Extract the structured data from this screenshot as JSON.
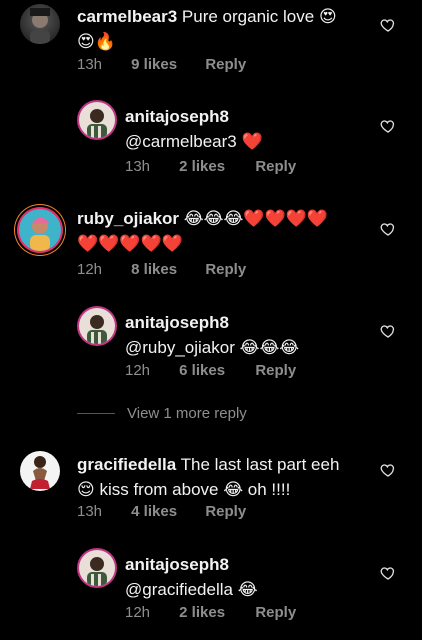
{
  "comments": [
    {
      "user": "carmelbear3",
      "text_line1": "Pure organic love 😍",
      "text_line2": "😍🔥",
      "time": "13h",
      "likes": "9 likes",
      "reply": "Reply"
    },
    {
      "user": "anitajoseph8",
      "text_line1": "@carmelbear3 ❤️",
      "time": "13h",
      "likes": "2 likes",
      "reply": "Reply"
    },
    {
      "user": "ruby_ojiakor",
      "text_line1": "😂😂😂❤️❤️❤️❤️",
      "text_line2": "❤️❤️❤️❤️❤️",
      "time": "12h",
      "likes": "8 likes",
      "reply": "Reply"
    },
    {
      "user": "anitajoseph8",
      "text_line1": "@ruby_ojiakor 😂😂😂",
      "time": "12h",
      "likes": "6 likes",
      "reply": "Reply"
    },
    {
      "user": "gracifiedella",
      "text_line1": "The last last part eeh",
      "text_line2": "😌 kiss from above 😂 oh !!!!",
      "time": "13h",
      "likes": "4 likes",
      "reply": "Reply"
    },
    {
      "user": "anitajoseph8",
      "text_line1": "@gracifiedella 😂",
      "time": "12h",
      "likes": "2 likes",
      "reply": "Reply"
    }
  ],
  "view_more": "View 1 more reply",
  "icons": {
    "like": "heart-outline-icon"
  },
  "colors": {
    "meta": "#8e8e8e",
    "background": "#000000",
    "text": "#f2f2f2"
  }
}
